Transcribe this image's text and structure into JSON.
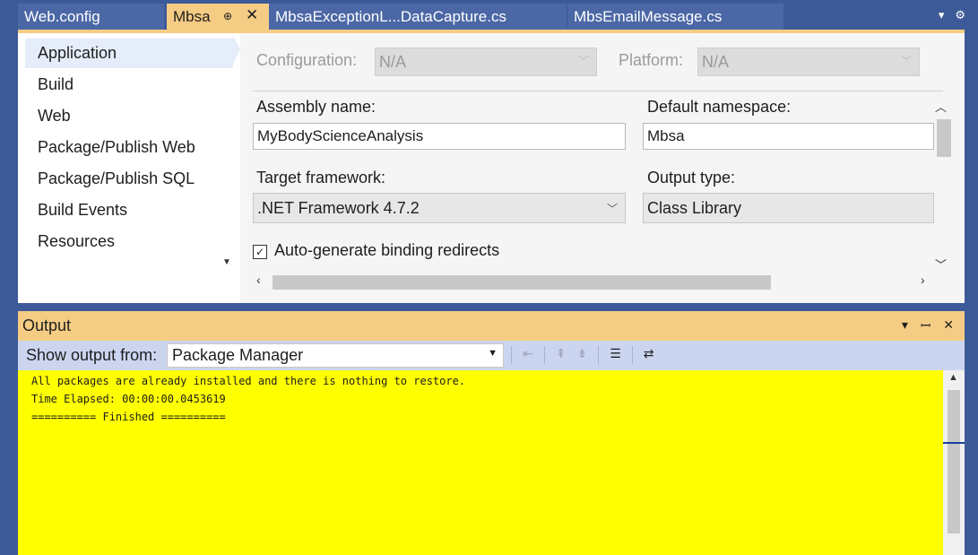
{
  "tabs": [
    {
      "label": "Web.config"
    },
    {
      "label": "Mbsa",
      "pin": "⊕",
      "close": "✕"
    },
    {
      "label": "MbsaExceptionL...DataCapture.cs"
    },
    {
      "label": "MbsEmailMessage.cs"
    }
  ],
  "nav": {
    "items": [
      "Application",
      "Build",
      "Web",
      "Package/Publish Web",
      "Package/Publish SQL",
      "Build Events",
      "Resources"
    ]
  },
  "config": {
    "configuration_label": "Configuration:",
    "configuration_value": "N/A",
    "platform_label": "Platform:",
    "platform_value": "N/A"
  },
  "application": {
    "assembly_name_label": "Assembly name:",
    "assembly_name_value": "MyBodyScienceAnalysis",
    "default_namespace_label": "Default namespace:",
    "default_namespace_value": "Mbsa",
    "target_framework_label": "Target framework:",
    "target_framework_value": ".NET Framework 4.7.2",
    "output_type_label": "Output type:",
    "output_type_value": "Class Library",
    "auto_generate_label": "Auto-generate binding redirects",
    "auto_generate_checked": true
  },
  "output": {
    "title": "Output",
    "show_from_label": "Show output from:",
    "show_from_value": "Package Manager",
    "lines": [
      "All packages are already installed and there is nothing to restore.",
      "Time Elapsed: 00:00:00.0453619",
      "========== Finished =========="
    ]
  },
  "colors": {
    "accent_tab": "#f5cc84",
    "output_background": "#ffff00",
    "chrome": "#3d5a98"
  }
}
